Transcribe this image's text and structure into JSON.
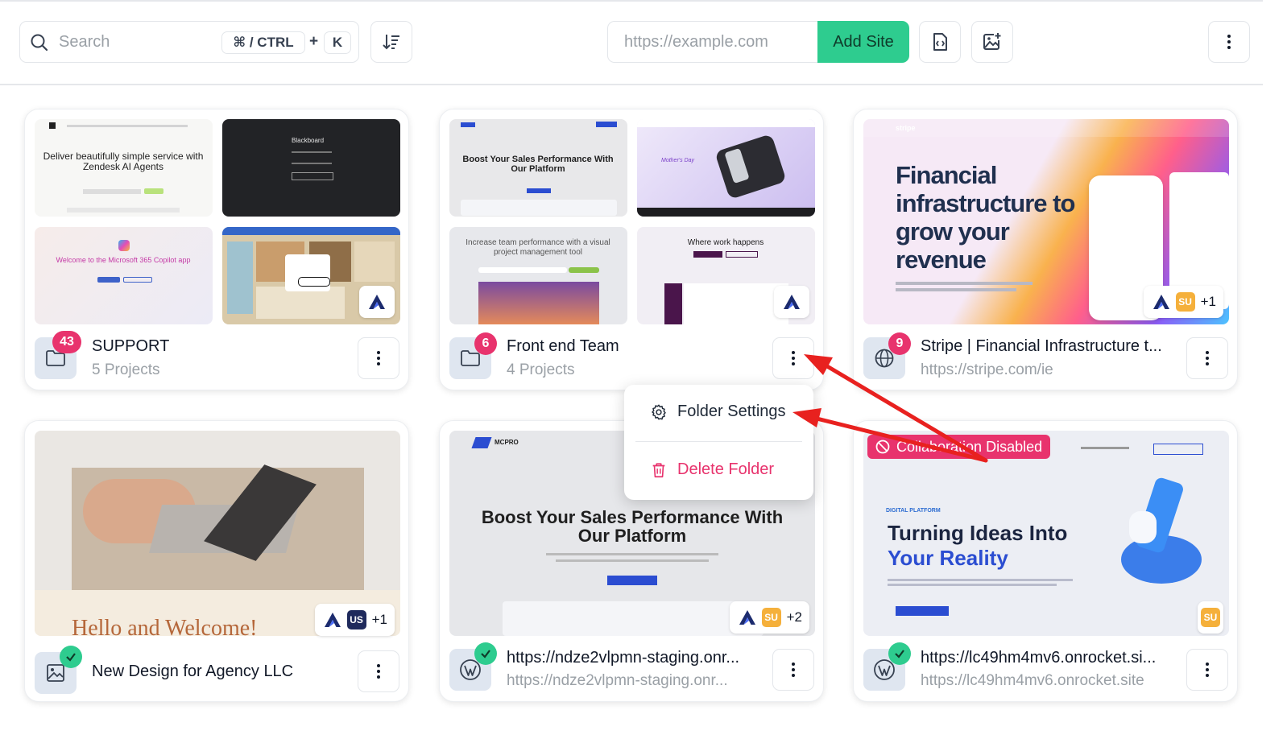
{
  "toolbar": {
    "search_placeholder": "Search",
    "shortcut_modifier": "⌘ / CTRL",
    "shortcut_plus": "+",
    "shortcut_key": "K",
    "url_placeholder": "https://example.com",
    "add_site_label": "Add Site"
  },
  "cards": [
    {
      "title": "SUPPORT",
      "subtitle": "5 Projects",
      "count": "43",
      "type": "folder"
    },
    {
      "title": "Front end Team",
      "subtitle": "4 Projects",
      "count": "6",
      "type": "folder"
    },
    {
      "title": "Stripe | Financial Infrastructure t...",
      "subtitle": "https://stripe.com/ie",
      "count": "9",
      "type": "site",
      "extra_count": "+1",
      "avatar": "SU"
    },
    {
      "title": "New Design for Agency LLC",
      "type": "design",
      "extra_count": "+1",
      "avatar": "US"
    },
    {
      "title": "https://ndze2vlpmn-staging.onr...",
      "subtitle": "https://ndze2vlpmn-staging.onr...",
      "type": "wordpress",
      "extra_count": "+2",
      "avatar": "SU"
    },
    {
      "title": "https://lc49hm4mv6.onrocket.si...",
      "subtitle": "https://lc49hm4mv6.onrocket.site",
      "type": "wordpress",
      "avatar": "SU",
      "collab_label": "Collaboration Disabled"
    }
  ],
  "thumbnails": {
    "zendesk": {
      "headline": "Deliver beautifully simple service with Zendesk AI Agents"
    },
    "blackboard": {
      "headline": "Blackboard"
    },
    "copilot": {
      "headline": "Welcome to the Microsoft 365 Copilot app"
    },
    "boost": {
      "headline": "Boost Your Sales Performance With Our Platform"
    },
    "mothers": {
      "headline": "Mother's Day"
    },
    "teamwork": {
      "headline": "Increase team performance with a visual project management tool"
    },
    "where": {
      "headline": "Where work happens"
    },
    "stripe": {
      "headline": "Financial infrastructure to grow your revenue"
    },
    "hello": {
      "headline": "Hello and Welcome!"
    },
    "mcpro": {
      "brand": "MCPRO",
      "headline": "Boost Your Sales Performance With Our Platform"
    },
    "ideas": {
      "eyebrow": "DIGITAL PLATFORM",
      "headline1": "Turning Ideas Into",
      "headline2": "Your Reality"
    }
  },
  "menu": {
    "settings_label": "Folder Settings",
    "delete_label": "Delete Folder"
  },
  "colors": {
    "accent": "#2ecc8f",
    "badge": "#e8336d",
    "arrow": "#e8211f"
  }
}
